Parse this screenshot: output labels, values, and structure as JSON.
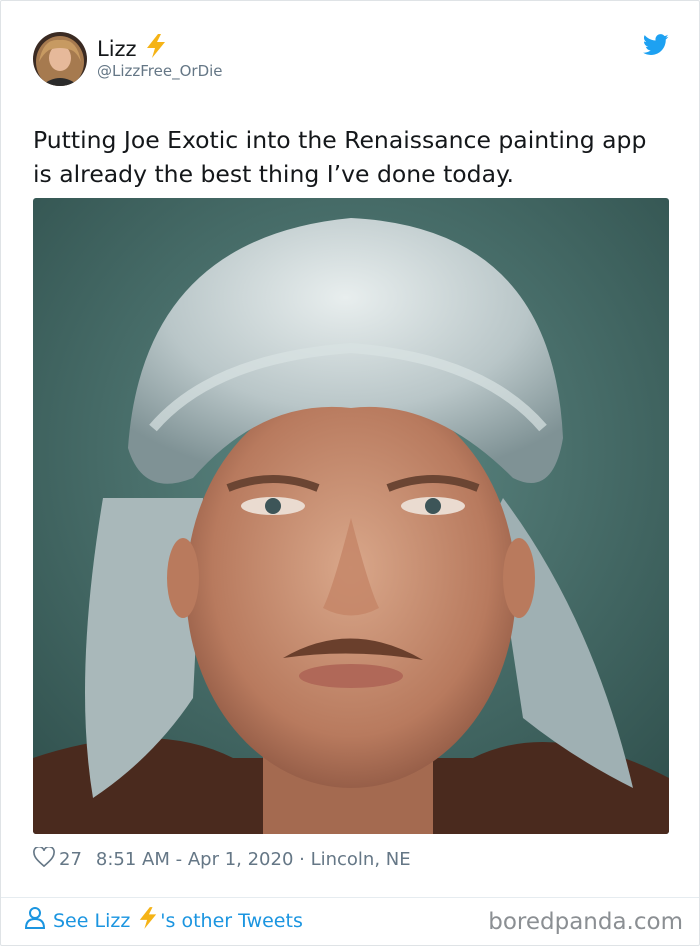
{
  "tweet": {
    "author_name": "Lizz",
    "handle": "@LizzFree_OrDie",
    "text": "Putting Joe Exotic into the Renaissance painting app\nis already the best thing I’ve done today.",
    "likes": "27",
    "timestamp": "8:51 AM - Apr 1, 2020",
    "separator": " · ",
    "location": "Lincoln, NE"
  },
  "footer": {
    "see_prefix": "See Lizz",
    "see_suffix": "'s other Tweets",
    "watermark": "boredpanda.com"
  },
  "icons": {
    "verified_bolt": "lightning-bolt-emoji",
    "platform": "twitter-bird-icon",
    "like": "heart-outline-icon",
    "profile": "person-outline-icon"
  },
  "colors": {
    "link_blue": "#1b95e0",
    "meta_gray": "#657786",
    "bolt_yellow": "#f5b316"
  }
}
